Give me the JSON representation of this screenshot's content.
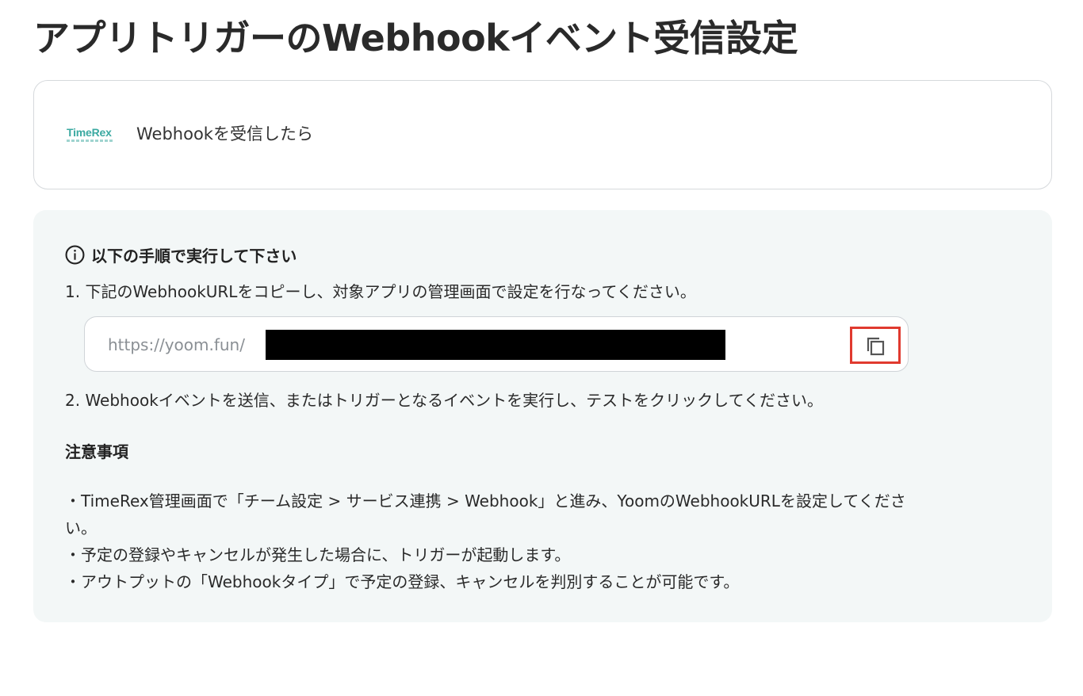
{
  "page": {
    "title": "アプリトリガーのWebhookイベント受信設定"
  },
  "trigger": {
    "app_logo_text": "TimeRex",
    "label": "Webhookを受信したら"
  },
  "instructions": {
    "heading": "以下の手順で実行して下さい",
    "step1": "1. 下記のWebhookURLをコピーし、対象アプリの管理画面で設定を行なってください。",
    "url_prefix": "https://yoom.fun/",
    "copy_icon": "copy-icon",
    "step2": "2. Webhookイベントを送信、またはトリガーとなるイベントを実行し、テストをクリックしてください。"
  },
  "notes": {
    "heading": "注意事項",
    "items": [
      "・TimeRex管理画面で「チーム設定 > サービス連携 > Webhook」と進み、YoomのWebhookURLを設定してくださ",
      "い。",
      "・予定の登録やキャンセルが発生した場合に、トリガーが起動します。",
      "・アウトプットの「Webhookタイプ」で予定の登録、キャンセルを判別することが可能です。"
    ]
  },
  "colors": {
    "panel_background": "#f3f7f7",
    "highlight_border": "#e03a2f",
    "logo_accent": "#3aa9a1"
  }
}
